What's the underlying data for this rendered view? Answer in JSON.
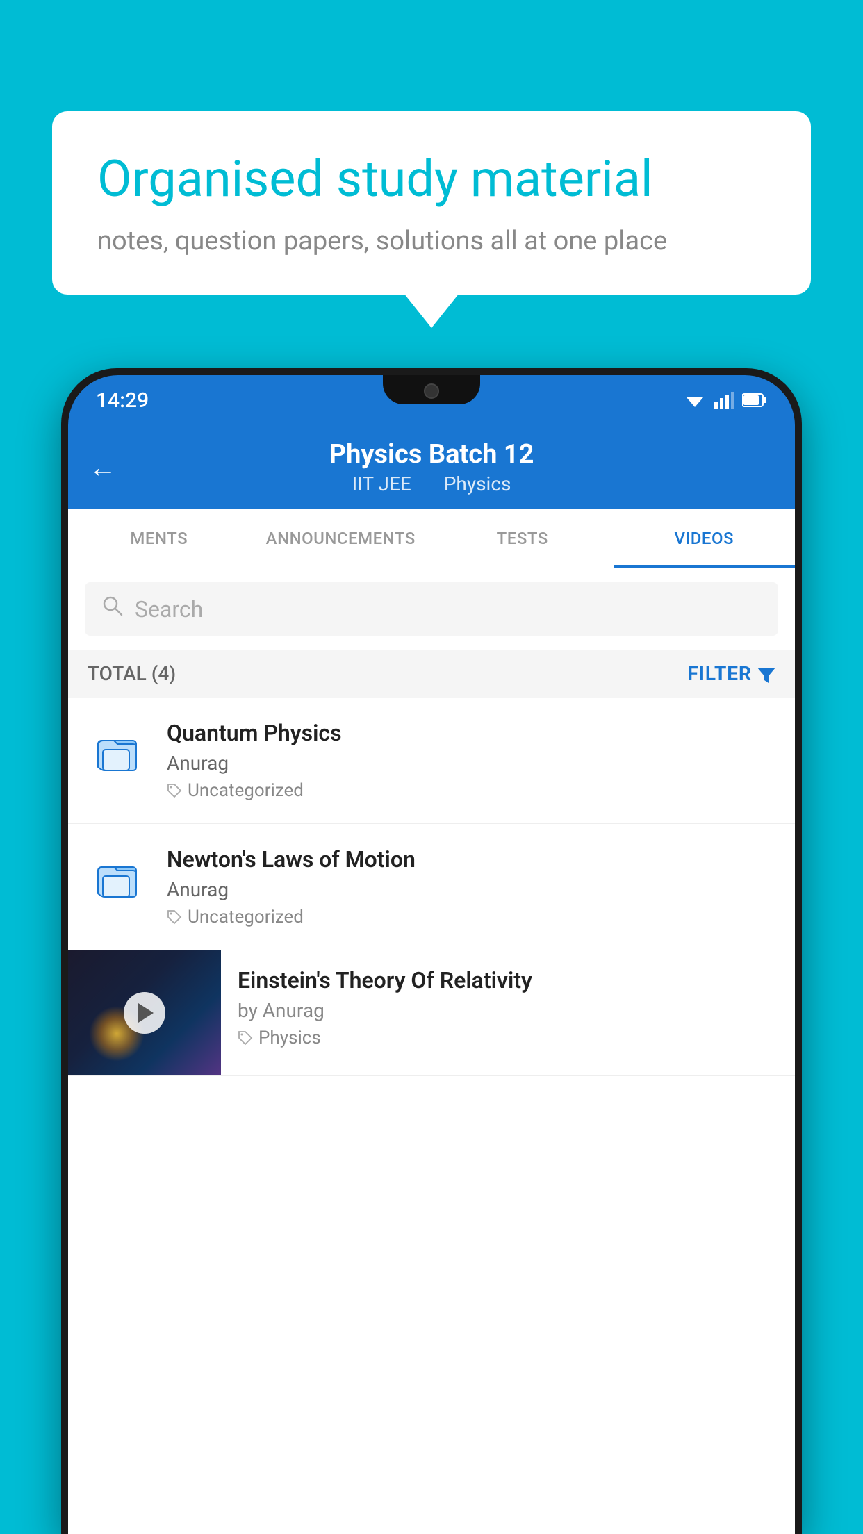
{
  "background_color": "#00bcd4",
  "speech_bubble": {
    "title": "Organised study material",
    "subtitle": "notes, question papers, solutions all at one place"
  },
  "phone": {
    "status_bar": {
      "time": "14:29"
    },
    "header": {
      "back_label": "←",
      "title": "Physics Batch 12",
      "subtitle_part1": "IIT JEE",
      "subtitle_part2": "Physics"
    },
    "tabs": [
      {
        "label": "MENTS",
        "active": false
      },
      {
        "label": "ANNOUNCEMENTS",
        "active": false
      },
      {
        "label": "TESTS",
        "active": false
      },
      {
        "label": "VIDEOS",
        "active": true
      }
    ],
    "search": {
      "placeholder": "Search"
    },
    "filter_row": {
      "total_label": "TOTAL (4)",
      "filter_label": "FILTER"
    },
    "videos": [
      {
        "id": 1,
        "title": "Quantum Physics",
        "author": "Anurag",
        "tag": "Uncategorized",
        "has_thumb": false
      },
      {
        "id": 2,
        "title": "Newton's Laws of Motion",
        "author": "Anurag",
        "tag": "Uncategorized",
        "has_thumb": false
      },
      {
        "id": 3,
        "title": "Einstein's Theory Of Relativity",
        "author": "by Anurag",
        "tag": "Physics",
        "has_thumb": true
      }
    ]
  }
}
